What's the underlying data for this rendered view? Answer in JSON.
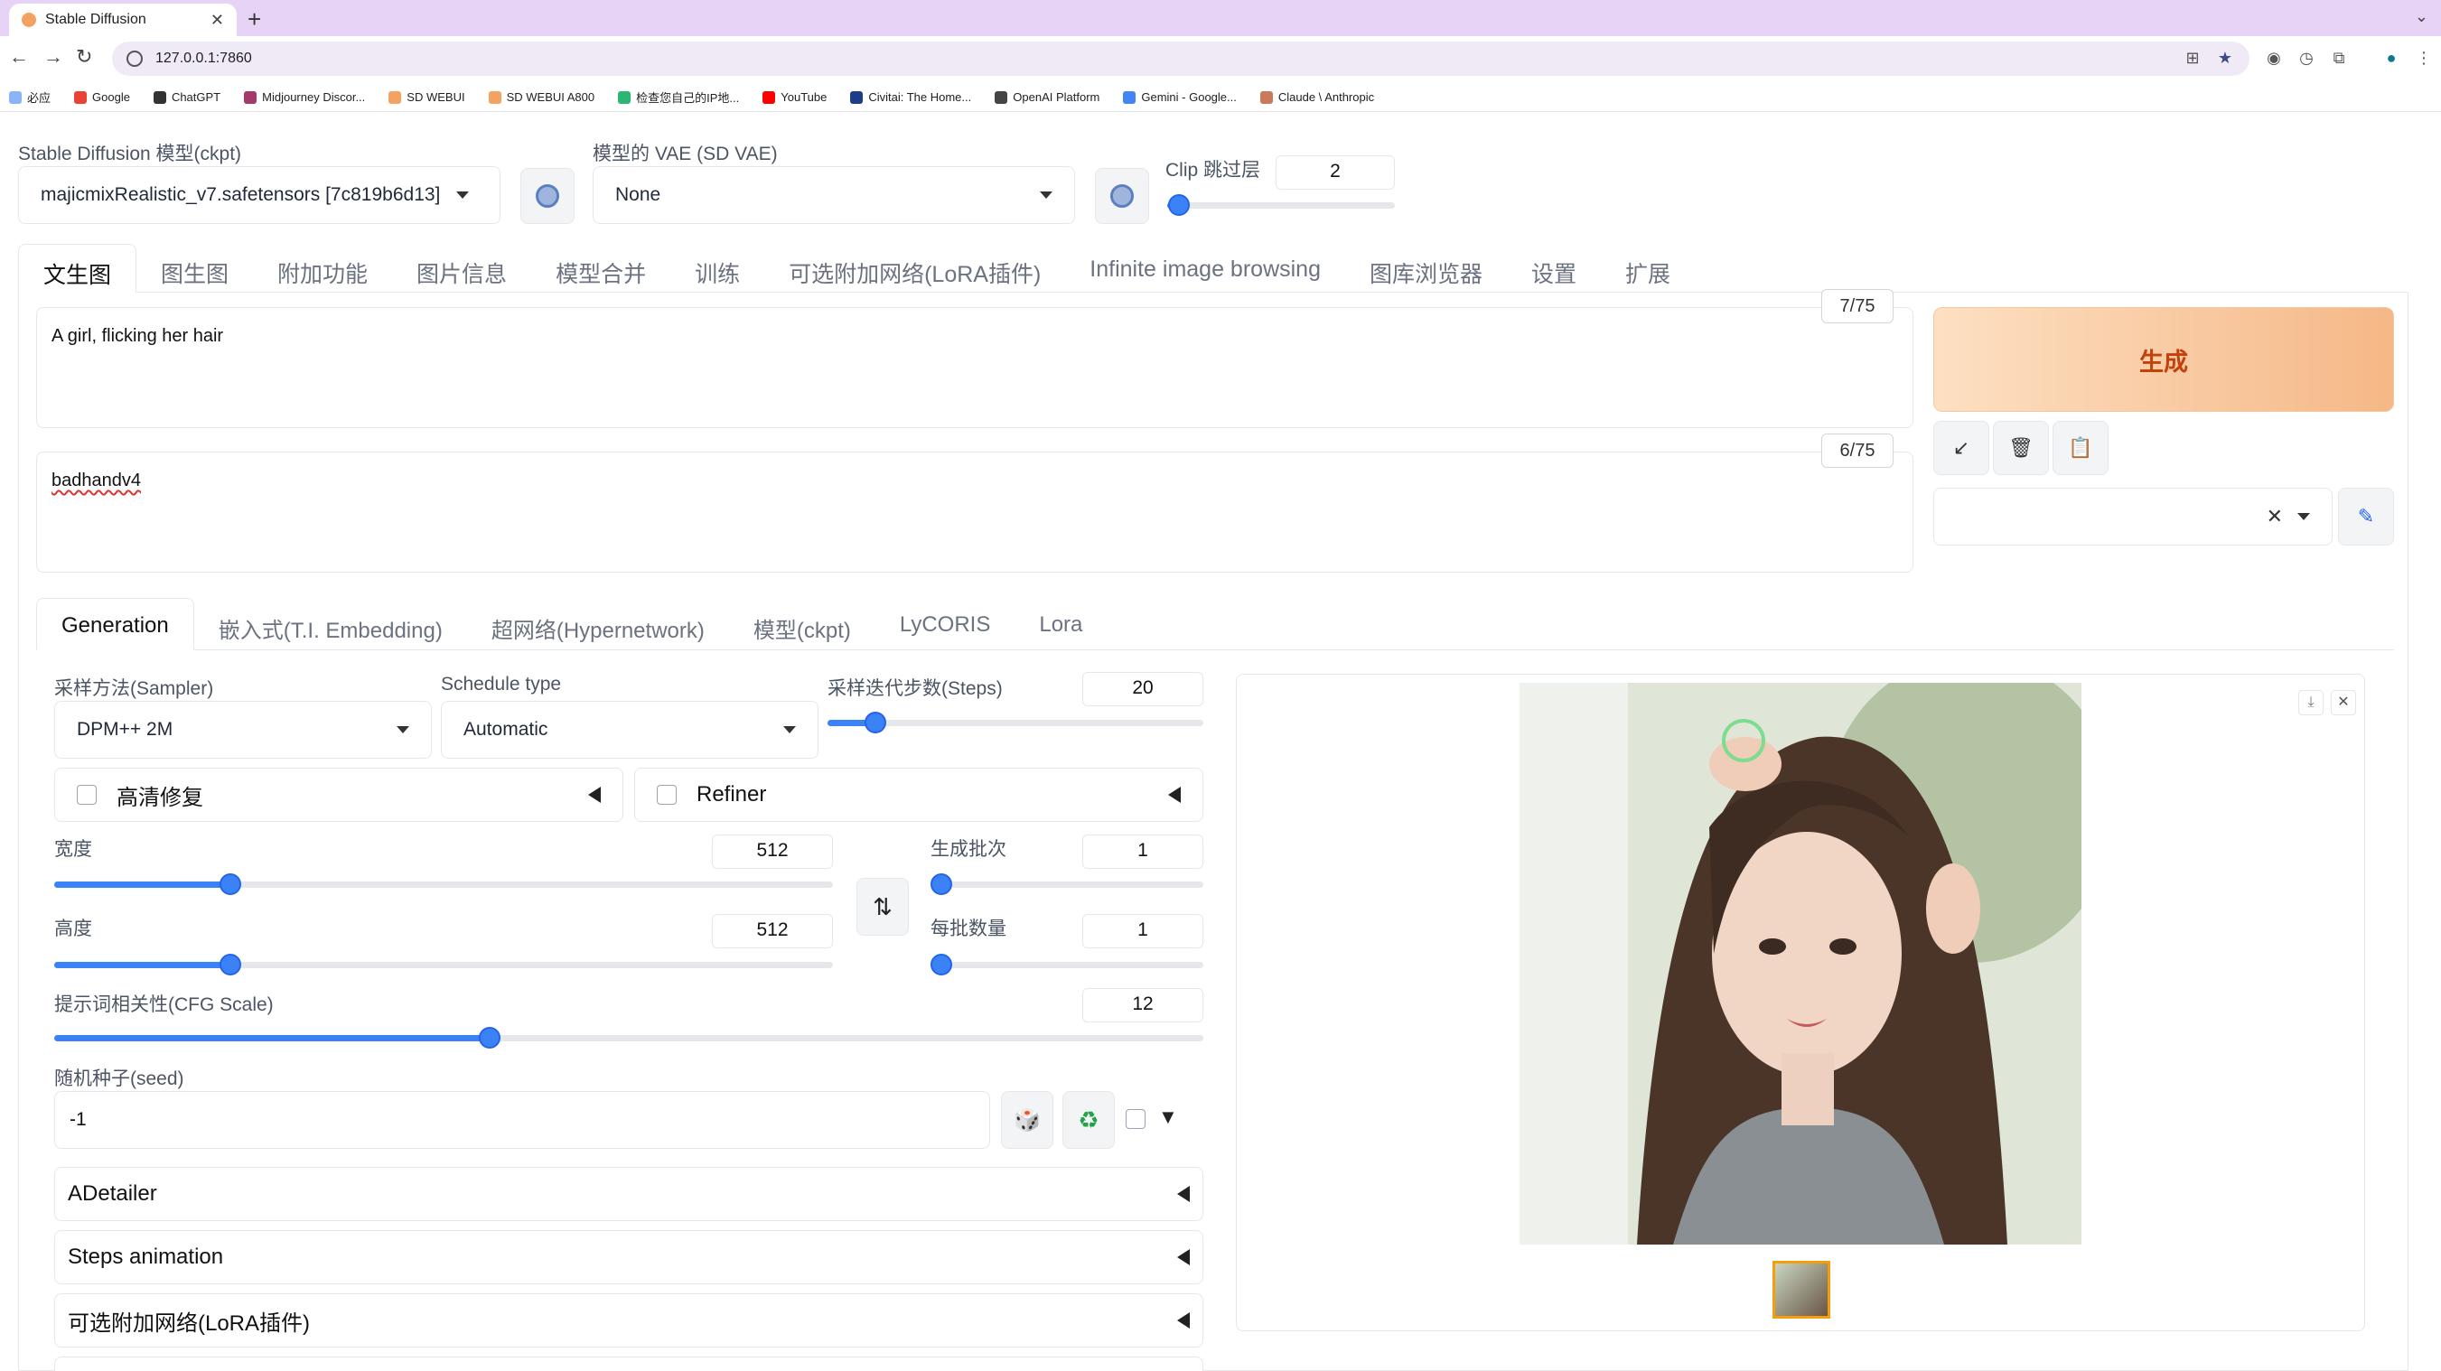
{
  "browser": {
    "tab_title": "Stable Diffusion",
    "url": "127.0.0.1:7860",
    "bookmarks": [
      "必应",
      "Google",
      "ChatGPT",
      "Midjourney Discor...",
      "SD WEBUI",
      "SD WEBUI A800",
      "检查您自己的IP地...",
      "YouTube",
      "Civitai: The Home...",
      "OpenAI Platform",
      "Gemini - Google...",
      "Claude \\ Anthropic"
    ]
  },
  "top": {
    "ckpt_label": "Stable Diffusion 模型(ckpt)",
    "ckpt_value": "majicmixRealistic_v7.safetensors [7c819b6d13]",
    "vae_label": "模型的 VAE (SD VAE)",
    "vae_value": "None",
    "clip_label": "Clip 跳过层",
    "clip_value": "2",
    "clip_fraction": 0.05
  },
  "main_tabs": [
    "文生图",
    "图生图",
    "附加功能",
    "图片信息",
    "模型合并",
    "训练",
    "可选附加网络(LoRA插件)",
    "Infinite image browsing",
    "图库浏览器",
    "设置",
    "扩展"
  ],
  "prompt": {
    "positive": "A girl, flicking her hair",
    "positive_count": "7/75",
    "negative": "badhandv4",
    "negative_count": "6/75"
  },
  "generate_label": "生成",
  "sub_tabs": [
    "Generation",
    "嵌入式(T.I. Embedding)",
    "超网络(Hypernetwork)",
    "模型(ckpt)",
    "LyCORIS",
    "Lora"
  ],
  "params": {
    "sampler_label": "采样方法(Sampler)",
    "sampler_value": "DPM++ 2M",
    "schedule_label": "Schedule type",
    "schedule_value": "Automatic",
    "steps_label": "采样迭代步数(Steps)",
    "steps_value": "20",
    "hires_label": "高清修复",
    "refiner_label": "Refiner",
    "width_label": "宽度",
    "width_value": "512",
    "height_label": "高度",
    "height_value": "512",
    "batch_count_label": "生成批次",
    "batch_count_value": "1",
    "batch_size_label": "每批数量",
    "batch_size_value": "1",
    "cfg_label": "提示词相关性(CFG Scale)",
    "cfg_value": "12",
    "seed_label": "随机种子(seed)",
    "seed_value": "-1"
  },
  "accordions": [
    "ADetailer",
    "Steps animation",
    "可选附加网络(LoRA插件)"
  ],
  "colors": {
    "accent": "#3b82f6",
    "generate_text": "#c2410c",
    "tab_bar": "#e7d3f5"
  }
}
